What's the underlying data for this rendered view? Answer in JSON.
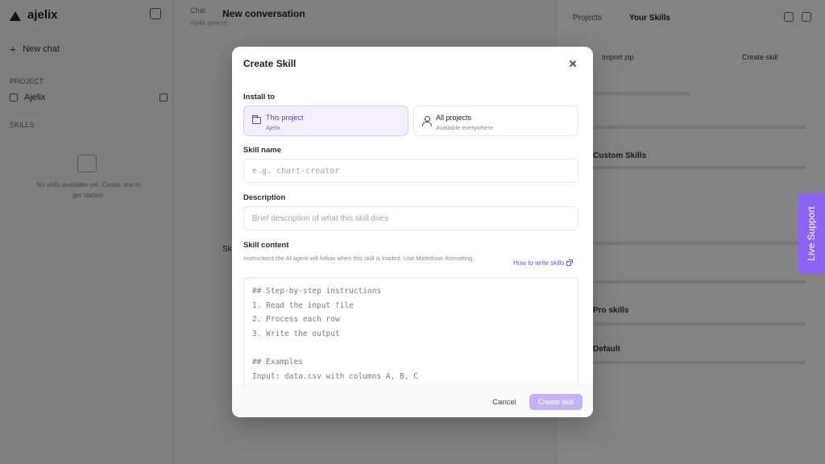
{
  "app": {
    "brand": "ajelix",
    "sidebar": {
      "new_chat": "New chat",
      "projects_label": "PROJECT",
      "project_name": "Ajelix",
      "skills_label": "SKILLS",
      "empty_text": "No skills available yet. Create one to get started."
    },
    "main": {
      "breadcrumb": "Chat",
      "title": "New conversation",
      "subtitle": "Ajelix project",
      "section": "Skills"
    },
    "right_panel": {
      "tab1": "Projects",
      "tab2": "Your Skills",
      "btn1": "Import zip",
      "btn2": "Create skill",
      "head1": "Custom Skills",
      "head2": "Pro skills",
      "head3": "Default"
    }
  },
  "modal": {
    "title": "Create Skill",
    "install_label": "Install to",
    "options": [
      {
        "title": "This project",
        "subtitle": "Ajelix",
        "icon": "folder-icon",
        "selected": true
      },
      {
        "title": "All projects",
        "subtitle": "Available everywhere",
        "icon": "user-icon",
        "selected": false
      }
    ],
    "skill_name_label": "Skill name",
    "skill_name_placeholder": "e.g. chart-creator",
    "description_label": "Description",
    "description_placeholder": "Brief description of what this skill does",
    "content_label": "Skill content",
    "content_help": "Instructions the AI agent will follow when this skill is loaded. Use Markdown formatting.",
    "help_link": "How to write skills",
    "content_lines": [
      "## Step-by-step instructions",
      "1. Read the input file",
      "2. Process each row",
      "3. Write the output",
      "",
      "## Examples",
      "Input: data.csv with columns A, B, C"
    ],
    "cancel_label": "Cancel",
    "create_label": "Create skill"
  },
  "live_support": "Live Support",
  "colors": {
    "accent": "#6a4fd8",
    "create_button": "#c3b3f3",
    "live_support": "#8a64f2",
    "selected_card": "#f3effd"
  }
}
